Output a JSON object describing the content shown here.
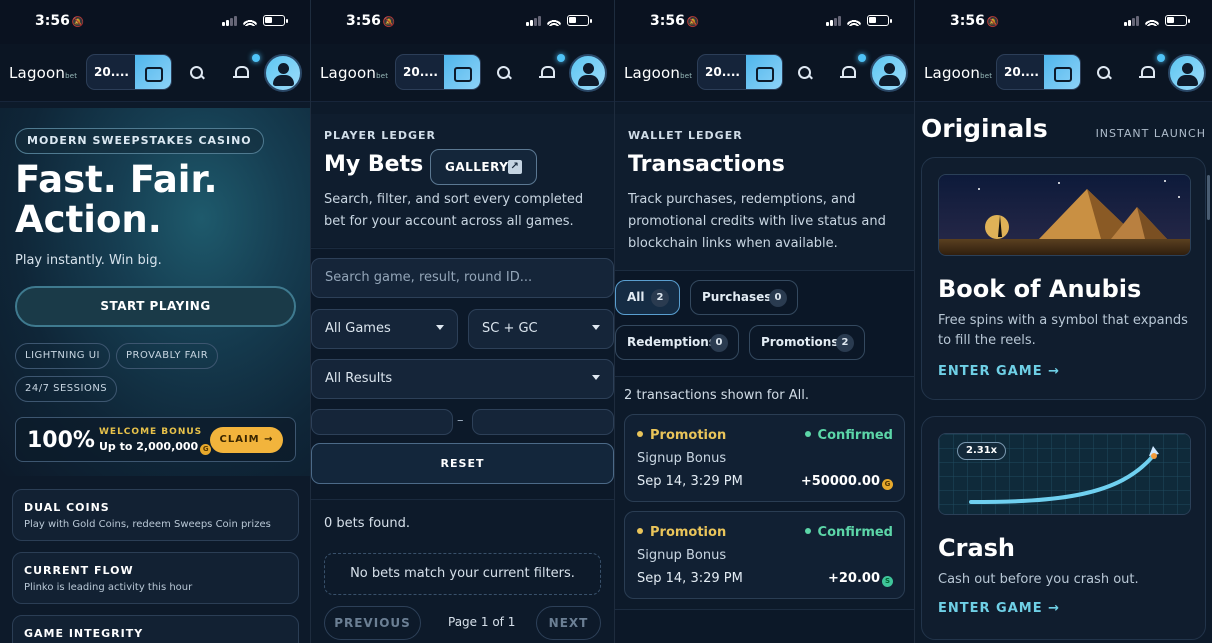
{
  "status": {
    "time": "3:56"
  },
  "nav": {
    "logo": "Lagoon",
    "logo_suffix": "bet",
    "balance": "20...."
  },
  "home": {
    "tag": "MODERN SWEEPSTAKES CASINO",
    "headline_1": "Fast. Fair.",
    "headline_2": "Action.",
    "subline": "Play instantly. Win big.",
    "start_label": "START PLAYING",
    "chips": [
      "LIGHTNING UI",
      "PROVABLY FAIR",
      "24/7 SESSIONS"
    ],
    "bonus": {
      "percent": "100%",
      "label": "WELCOME BONUS",
      "amount": "Up to 2,000,000",
      "claim": "CLAIM →"
    },
    "features": [
      {
        "title": "DUAL COINS",
        "desc": "Play with Gold Coins, redeem Sweeps Coin prizes"
      },
      {
        "title": "CURRENT FLOW",
        "desc": "Plinko is leading activity this hour"
      },
      {
        "title": "GAME INTEGRITY",
        "desc": ""
      }
    ]
  },
  "bets": {
    "eyebrow": "PLAYER LEDGER",
    "title": "My Bets",
    "gallery": "GALLERY",
    "desc_1": "Search, filter, and sort every completed",
    "desc_2": "bet for your account across all games.",
    "search_placeholder": "Search game, result, round ID...",
    "games_select": "All Games",
    "currency_select": "SC + GC",
    "results_select": "All Results",
    "range_sep": "–",
    "reset": "RESET",
    "found": "0 bets found.",
    "empty": "No bets match your current filters.",
    "prev": "PREVIOUS",
    "page": "Page 1 of 1",
    "next": "NEXT"
  },
  "transactions": {
    "eyebrow": "WALLET LEDGER",
    "title": "Transactions",
    "desc_1": "Track purchases, redemptions, and",
    "desc_2": "promotional credits with live status and",
    "desc_3": "blockchain links when available.",
    "filters": [
      {
        "label": "All",
        "count": "2",
        "active": true
      },
      {
        "label": "Purchases",
        "count": "0",
        "active": false
      },
      {
        "label": "Redemptions",
        "count": "0",
        "active": false
      },
      {
        "label": "Promotions",
        "count": "2",
        "active": false
      }
    ],
    "shown": "2 transactions shown for All.",
    "items": [
      {
        "type": "Promotion",
        "status": "Confirmed",
        "name": "Signup Bonus",
        "date": "Sep 14, 3:29 PM",
        "amount": "+50000.00",
        "coin": "G"
      },
      {
        "type": "Promotion",
        "status": "Confirmed",
        "name": "Signup Bonus",
        "date": "Sep 14, 3:29 PM",
        "amount": "+20.00",
        "coin": "S"
      }
    ]
  },
  "originals": {
    "title": "Originals",
    "subtitle": "INSTANT LAUNCH",
    "games": [
      {
        "name": "Book of Anubis",
        "desc": "Free spins with a symbol that expands to fill the reels.",
        "cta": "ENTER GAME →"
      },
      {
        "name": "Crash",
        "desc": "Cash out before you crash out.",
        "cta": "ENTER GAME →",
        "multiplier": "2.31x"
      }
    ]
  },
  "colors": {
    "accent": "#4fc3f7",
    "gold": "#f2b43c",
    "confirmed": "#5cd6a8",
    "promotion": "#e9c45a"
  }
}
